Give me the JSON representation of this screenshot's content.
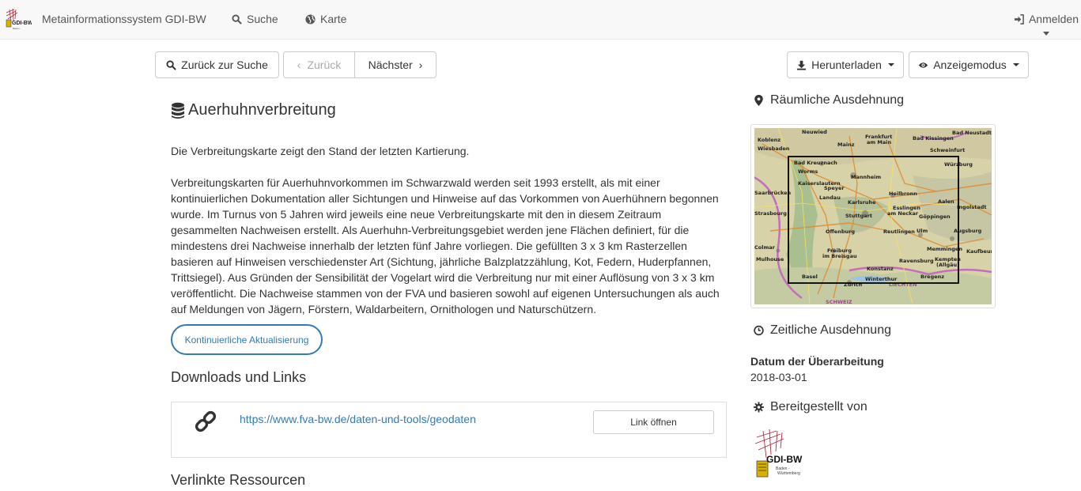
{
  "navbar": {
    "brand": "Metainformationssystem GDI-BW",
    "search_label": "Suche",
    "map_label": "Karte",
    "login_label": "Anmelden"
  },
  "toolbar": {
    "back_to_search": "Zurück zur Suche",
    "prev": "Zurück",
    "next": "Nächster",
    "download": "Herunterladen",
    "display_mode": "Anzeigemodus"
  },
  "record": {
    "title": "Auerhuhnverbreitung",
    "summary": "Die Verbreitungskarte zeigt den Stand der letzten Kartierung.",
    "description": "Verbreitungskarten für Auerhuhnvorkommen im Schwarzwald werden seit 1993 erstellt, als mit einer kontinuierlichen Dokumentation aller Sichtungen und Hinweise auf das Vorkommen von Auerhühnern begonnen wurde. Im Turnus von 5 Jahren wird jeweils eine neue Verbreitungskarte mit den in diesem Zeitraum gesammelten Nachweisen erstellt. Als Auerhuhn-Verbreitungsgebiet werden jene Flächen definiert, für die mindestens drei Nachweise innerhalb der letzten fünf Jahre vorliegen. Die gefüllten 3 x 3 km Rasterzellen basieren auf Hinweisen verschiedenster Art (Sichtung, jährliche Balzplatzzählung, Kot, Federn, Huderpfannen, Trittsiegel). Aus Gründen der Sensibilität der Vogelart wird die Verbreitung nur mit einer Auflösung von 3 x 3 km veröffentlicht. Die Nachweise stammen von der FVA und basieren sowohl auf eigenen Untersuchungen als auch auf Meldungen von Jägern, Förstern, Waldarbeitern, Ornithologen und Naturschützern.",
    "update_badge": "Kontinuierliche Aktualisierung"
  },
  "downloads": {
    "heading": "Downloads und Links",
    "items": [
      {
        "url": "https://www.fva-bw.de/daten-und-tools/geodaten",
        "button": "Link öffnen"
      }
    ]
  },
  "linked_resources": {
    "heading": "Verlinkte Ressourcen"
  },
  "sidebar": {
    "spatial_heading": "Räumliche Ausdehnung",
    "temporal_heading": "Zeitliche Ausdehnung",
    "date_label": "Datum der Überarbeitung",
    "date_value": "2018-03-01",
    "provider_heading": "Bereitgestellt von",
    "provider_logo_text": "GDI-BW",
    "provider_logo_sub": "Baden-Württemberg"
  },
  "map_labels": [
    "Neuwied",
    "Koblenz",
    "Frankfurt am Main",
    "Wiesbaden",
    "Mainz",
    "Bad Kreuznach",
    "Worms",
    "Mannheim",
    "Würzburg",
    "Kaiserslautern",
    "Heilbronn",
    "Karlsruhe",
    "Stuttgart",
    "Esslingen am Neckar",
    "Göppingen",
    "Ingolstadt",
    "Strasbourg",
    "Offenburg",
    "Reutlingen",
    "Ulm",
    "Augsburg",
    "Colmar",
    "Freiburg im Breisgau",
    "Ravensburg",
    "Kempten (Allgäu)",
    "Mulhouse",
    "Basel",
    "Zürich",
    "Winterthur",
    "Konstanz",
    "SCHWEIZ",
    "Bad Neustadt",
    "Bad Kissingen",
    "Schweinfurt",
    "Saarbrücken",
    "Landau",
    "Speyer",
    "Aalen",
    "Memmingen",
    "Kaufbeuren",
    "Bregenz",
    "LIECHTEN"
  ],
  "colors": {
    "link": "#337ab7",
    "navbar_bg": "#f8f8f8",
    "border": "#ccc"
  }
}
